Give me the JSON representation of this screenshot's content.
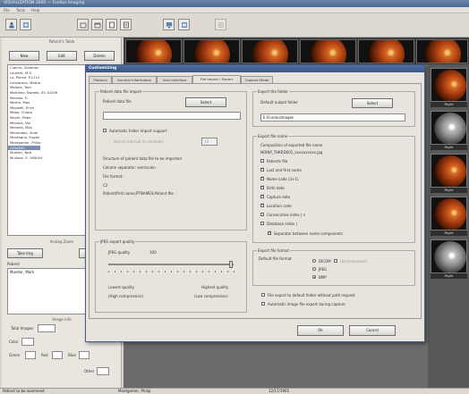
{
  "app": {
    "title": "VISUALIZATION 3000 — Fundus Imaging",
    "menu": [
      "File",
      "Tools",
      "Help"
    ]
  },
  "toolbar": {
    "icons": [
      "patient-icon",
      "export-icon",
      "folder-icon",
      "folder-open-icon",
      "page-icon",
      "monitor-icon",
      "document-icon",
      "settings-icon"
    ]
  },
  "left": {
    "patients_title": "Patient's Table",
    "new_label": "New",
    "edit_label": "Edit",
    "delete_label": "Delete",
    "patients": [
      "Cuervo, Salomon",
      "Laurent, M.S.",
      "La, Pierce, P.1112",
      "Lanzarone, Mattia",
      "Malone, Tom",
      "Martinez, Sweets, 00 10206",
      "Mariato, S.",
      "Martin, Max",
      "Maxwell, Erich",
      "Maaa, Chiara",
      "Meyer, Peter",
      "Mendes, Val",
      "Mendes, Max",
      "Menendez, Vinel",
      "Montagna, Eugen",
      "Montgomer, Philip",
      "1234567",
      "Mueller, Nad",
      "Mullova, S. 160004"
    ],
    "selected_index": 16,
    "analysis_title": "Analog Zoom",
    "take_img_label": "Take Img",
    "analog_label": "Analog",
    "patient_label": "Patient",
    "patient_value": "Mueller, Mark",
    "images_title": "Image info",
    "total_images_label": "Total Images",
    "color_label": "Color",
    "green_label": "Green",
    "red_label": "Red",
    "blue_label": "Blue",
    "other_label": "Other"
  },
  "right": {
    "labels": [
      "Right",
      "Right",
      "Right",
      "Right",
      "Right"
    ]
  },
  "dialog": {
    "title": "Customizing",
    "tabs": [
      "Protocol",
      "General Information",
      "User Interface",
      "File Import / Export",
      "Capture Mode"
    ],
    "active_tab": 3,
    "import": {
      "group_title": "Patient data file import",
      "file_label": "Patient data file",
      "select_label": "Select",
      "file_value": "",
      "auto_import_label": "Automatic folder import support",
      "interval_label": "Search interval (in seconds)",
      "interval_value": "10",
      "structure_label": "Structure of patient data file to be imported",
      "column_sep_label": "Column separator: semicolon",
      "file_format_label": "File format:",
      "format_value": "C2",
      "format_detail": "Patient/first name;PTNAMES;Patient file"
    },
    "export_folder": {
      "group_title": "Export the folder",
      "default_label": "Default output folder",
      "select_label": "Select",
      "path_value": "E:\\FundusImages"
    },
    "export_name": {
      "group_title": "Export file name",
      "composition_label": "Composition of exported file name",
      "composition_value": "NOINP_THKRD001_xxxxxxxxxx.jpg",
      "items": [
        {
          "label": "Patients file",
          "checked": false
        },
        {
          "label": "Last and first name",
          "checked": true
        },
        {
          "label": "Name code (3+1)",
          "checked": true
        },
        {
          "label": "Birth date",
          "checked": true
        },
        {
          "label": "Capture date",
          "checked": true
        },
        {
          "label": "Location code",
          "checked": true
        },
        {
          "label": "Consecutive index | n",
          "checked": false
        },
        {
          "label": "Database index |",
          "checked": false
        }
      ],
      "separator_label": "Separator between name components",
      "separator_checked": true
    },
    "jpeg": {
      "group_title": "JPEG export quality",
      "quality_label": "JPEG quality",
      "quality_value": "100",
      "quality_fraction": 0.98,
      "lowest_label": "Lowest quality",
      "lowest_sub": "(High compression)",
      "highest_label": "Highest quality",
      "highest_sub": "(Low compression)"
    },
    "export_format": {
      "group_title": "Export file format",
      "default_label": "Default file format",
      "options": [
        "DICOM",
        "JPEG",
        "BMP"
      ],
      "selected": 2,
      "aux_label": "Uncompressed"
    },
    "export_options": [
      {
        "label": "File export to default folder without path request",
        "checked": false
      },
      {
        "label": "Automatic image file export during capture",
        "checked": false
      }
    ],
    "ok_label": "Ok",
    "cancel_label": "Cancel"
  },
  "status": {
    "left": "Patient to be examined",
    "name": "Montgomer, Philip",
    "date": "12/17/1965"
  }
}
